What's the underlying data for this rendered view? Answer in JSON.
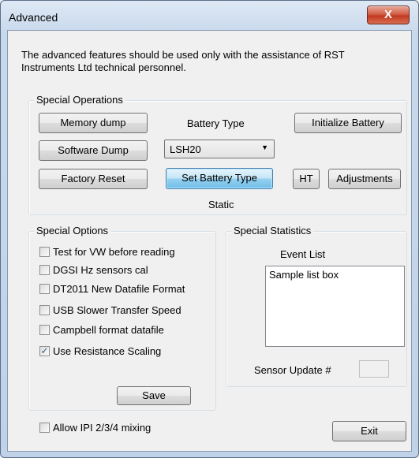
{
  "window": {
    "title": "Advanced",
    "close_glyph": "X"
  },
  "intro_text": "The advanced features should be used only with the assistance of RST Instruments Ltd technical personnel.",
  "special_operations": {
    "legend": "Special Operations",
    "memory_dump": "Memory dump",
    "battery_type_label": "Battery Type",
    "initialize_battery": "Initialize Battery",
    "software_dump": "Software Dump",
    "battery_select_value": "LSH20",
    "factory_reset": "Factory Reset",
    "set_battery_type": "Set Battery Type",
    "ht": "HT",
    "adjustments": "Adjustments",
    "static_label": "Static"
  },
  "special_options": {
    "legend": "Special Options",
    "items": [
      {
        "label": "Test for VW before reading",
        "checked": false,
        "mark": ""
      },
      {
        "label": "DGSI Hz sensors cal",
        "checked": false,
        "mark": ""
      },
      {
        "label": "DT2011 New Datafile Format",
        "checked": false,
        "mark": ""
      },
      {
        "label": "USB Slower Transfer Speed",
        "checked": false,
        "mark": ""
      },
      {
        "label": "Campbell format datafile",
        "checked": false,
        "mark": ""
      },
      {
        "label": "Use Resistance Scaling",
        "checked": true,
        "mark": "✓"
      }
    ],
    "save": "Save"
  },
  "special_statistics": {
    "legend": "Special Statistics",
    "event_list_label": "Event List",
    "event_list_items": [
      "Sample list box"
    ],
    "sensor_update_label": "Sensor Update #",
    "sensor_update_value": ""
  },
  "footer": {
    "allow_ipi": {
      "label": "Allow IPI 2/3/4 mixing",
      "checked": false,
      "mark": ""
    },
    "exit": "Exit"
  }
}
